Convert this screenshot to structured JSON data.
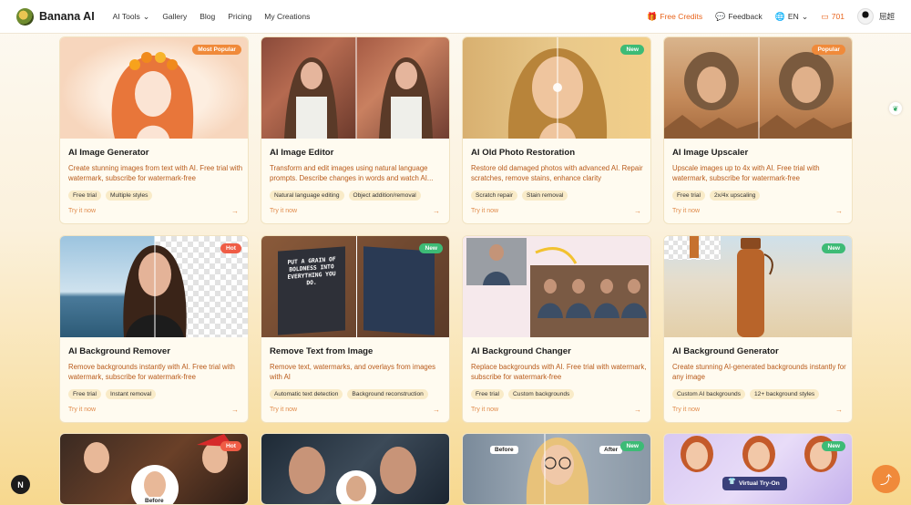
{
  "nav": {
    "brand": "Banana AI",
    "links": [
      "AI Tools",
      "Gallery",
      "Blog",
      "Pricing",
      "My Creations"
    ],
    "free_credits": "Free Credits",
    "feedback": "Feedback",
    "lang": "EN",
    "credits_count": "701",
    "user_name": "屈超"
  },
  "cards": [
    {
      "title": "AI Image Generator",
      "desc": "Create stunning images from text with AI. Free trial with watermark, subscribe for watermark-free",
      "tags": [
        "Free trial",
        "Multiple styles"
      ],
      "badge": "Most Popular",
      "try": "Try it now"
    },
    {
      "title": "AI Image Editor",
      "desc": "Transform and edit images using natural language prompts. Describe changes in words and watch AI...",
      "tags": [
        "Natural language editing",
        "Object addition/removal"
      ],
      "badge": "",
      "try": "Try it now"
    },
    {
      "title": "AI Old Photo Restoration",
      "desc": "Restore old damaged photos with advanced AI. Repair scratches, remove stains, enhance clarity",
      "tags": [
        "Scratch repair",
        "Stain removal"
      ],
      "badge": "New",
      "try": "Try it now"
    },
    {
      "title": "AI Image Upscaler",
      "desc": "Upscale images up to 4x with AI. Free trial with watermark, subscribe for watermark-free",
      "tags": [
        "Free trial",
        "2x/4x upscaling"
      ],
      "badge": "Popular",
      "try": "Try it now"
    },
    {
      "title": "AI Background Remover",
      "desc": "Remove backgrounds instantly with AI. Free trial with watermark, subscribe for watermark-free",
      "tags": [
        "Free trial",
        "Instant removal"
      ],
      "badge": "Hot",
      "try": "Try it now"
    },
    {
      "title": "Remove Text from Image",
      "desc": "Remove text, watermarks, and overlays from images with AI",
      "tags": [
        "Automatic text detection",
        "Background reconstruction"
      ],
      "badge": "New",
      "try": "Try it now"
    },
    {
      "title": "AI Background Changer",
      "desc": "Replace backgrounds with AI. Free trial with watermark, subscribe for watermark-free",
      "tags": [
        "Free trial",
        "Custom backgrounds"
      ],
      "badge": "",
      "try": "Try it now"
    },
    {
      "title": "AI Background Generator",
      "desc": "Create stunning AI-generated backgrounds instantly for any image",
      "tags": [
        "Custom AI backgrounds",
        "12+ background styles"
      ],
      "badge": "New",
      "try": "Try it now"
    },
    {
      "badge": "Hot",
      "label": "Before"
    },
    {
      "badge": ""
    },
    {
      "badge": "New",
      "label_before": "Before",
      "label_after": "After"
    },
    {
      "badge": "New",
      "label": "Virtual Try-On"
    }
  ],
  "book_text": "PUT A GRAIN OF BOLDNESS INTO EVERYTHING YOU DO.",
  "fab_icon": "share-icon",
  "corner_button": "N"
}
